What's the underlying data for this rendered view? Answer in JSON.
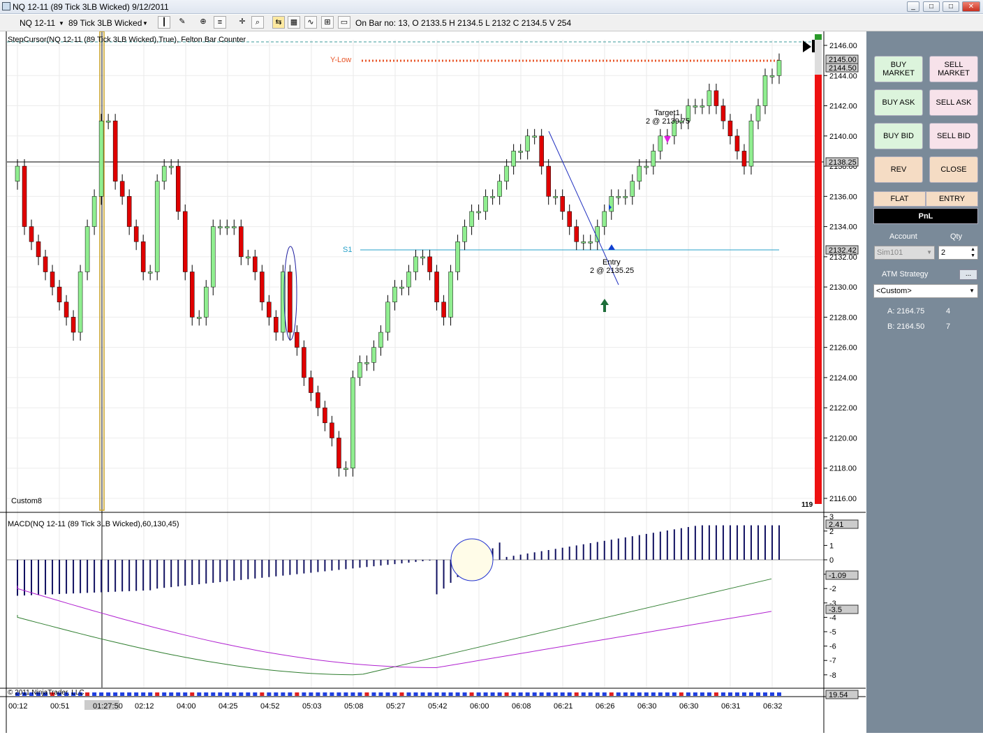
{
  "window": {
    "title": "NQ 12-11 (89 Tick 3LB Wicked)  9/12/2011",
    "min": "_",
    "max": "□",
    "close": "✕"
  },
  "toolbar": {
    "instrument": "NQ 12-11",
    "period": "89 Tick 3LB Wicked",
    "bar_info": "On Bar no: 13,  O 2133.5  H 2134.5  L 2132  C 2134.5  V 254"
  },
  "chart": {
    "indicator_label": "StepCursor(NQ 12-11 (89 Tick 3LB Wicked),True), Felton Bar Counter",
    "panel_label": "Custom8",
    "bar_counter": "119",
    "ylow_label": "Y-Low",
    "s1_label": "S1",
    "target_label": "Target1",
    "target_detail": "2 @ 2139.75",
    "entry_label": "Entry",
    "entry_detail": "2 @ 2135.25",
    "y_ticks": [
      "2146.00",
      "2144.00",
      "2142.00",
      "2140.00",
      "2138.00",
      "2136.00",
      "2134.00",
      "2132.00",
      "2130.00",
      "2128.00",
      "2126.00",
      "2124.00",
      "2122.00",
      "2120.00",
      "2118.00",
      "2116.00"
    ],
    "price_flags": {
      "a": "2145.00",
      "b": "2144.50",
      "c": "2138.25",
      "d": "2132.42"
    },
    "macd_label": "MACD(NQ 12-11 (89 Tick 3LB Wicked),60,130,45)",
    "macd_ticks": [
      "3",
      "2",
      "1",
      "0",
      "-1",
      "-2",
      "-3",
      "-4",
      "-5",
      "-6",
      "-7",
      "-8"
    ],
    "macd_flags": {
      "a": "2.41",
      "b": "-1.09",
      "c": "-3.5"
    },
    "bottom_flag": "19.54",
    "copyright": "© 2011 NinjaTrader, LLC",
    "x_ticks": [
      "00:12",
      "00:51",
      "01:27:50",
      "02:12",
      "04:00",
      "04:25",
      "04:52",
      "05:03",
      "05:08",
      "05:27",
      "05:42",
      "06:00",
      "06:08",
      "06:21",
      "06:26",
      "06:30",
      "06:30",
      "06:31",
      "06:32"
    ]
  },
  "panel": {
    "buy_market": "BUY MARKET",
    "sell_market": "SELL MARKET",
    "buy_ask": "BUY ASK",
    "sell_ask": "SELL ASK",
    "buy_bid": "BUY BID",
    "sell_bid": "SELL BID",
    "rev": "REV",
    "close": "CLOSE",
    "flat": "FLAT",
    "entry": "ENTRY",
    "pnl": "PnL",
    "account_label": "Account",
    "qty_label": "Qty",
    "account_value": "Sim101",
    "qty_value": "2",
    "atm_label": "ATM Strategy",
    "atm_more": "...",
    "atm_value": "<Custom>",
    "ask_label": "A: 2164.75",
    "ask_size": "4",
    "bid_label": "B: 2164.50",
    "bid_size": "7"
  },
  "colors": {
    "up": "#90ee90",
    "down": "#e00000",
    "macd_bar": "#101060",
    "line_green": "#2e7d2e",
    "line_purple": "#b020d0",
    "panel_bg": "#7a8a99"
  }
}
